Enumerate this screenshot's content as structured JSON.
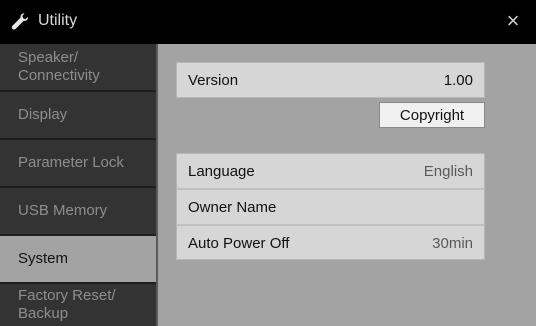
{
  "header": {
    "title": "Utility",
    "icon": "wrench-icon",
    "close_glyph": "×"
  },
  "sidebar": {
    "items": [
      {
        "label": "Speaker/\nConnectivity",
        "active": false
      },
      {
        "label": "Display",
        "active": false
      },
      {
        "label": "Parameter Lock",
        "active": false
      },
      {
        "label": "USB Memory",
        "active": false
      },
      {
        "label": "System",
        "active": true
      },
      {
        "label": "Factory Reset/\nBackup",
        "active": false
      }
    ]
  },
  "version": {
    "label": "Version",
    "value": "1.00"
  },
  "copyright_button": {
    "label": "Copyright"
  },
  "settings": {
    "language": {
      "label": "Language",
      "value": "English"
    },
    "owner_name": {
      "label": "Owner Name",
      "value": ""
    },
    "auto_power_off": {
      "label": "Auto Power Off",
      "value": "30min"
    }
  },
  "colors": {
    "title_bar": "#000000",
    "sidebar_tab": "#333333",
    "active_tab": "#a3a3a3",
    "panel": "#a3a3a3",
    "row": "#d6d6d6"
  }
}
